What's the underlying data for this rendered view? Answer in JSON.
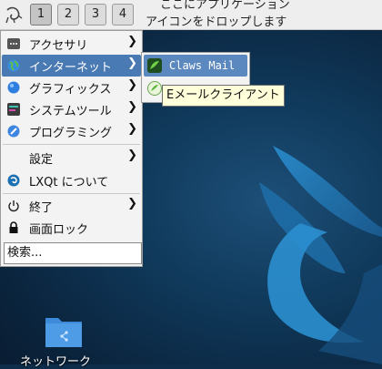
{
  "panel": {
    "desktops": [
      "1",
      "2",
      "3",
      "4"
    ],
    "active_desktop": "1",
    "quicklaunch_hint_line1": "ここにアプリケーション",
    "quicklaunch_hint_line2": "アイコンをドロップします"
  },
  "main_menu": {
    "items": [
      {
        "label": "アクセサリ",
        "icon": "accessories-icon",
        "has_submenu": true
      },
      {
        "label": "インターネット",
        "icon": "internet-globe-icon",
        "has_submenu": true,
        "highlighted": true
      },
      {
        "label": "グラフィックス",
        "icon": "graphics-icon",
        "has_submenu": true
      },
      {
        "label": "システムツール",
        "icon": "system-tools-icon",
        "has_submenu": true
      },
      {
        "label": "プログラミング",
        "icon": "programming-icon",
        "has_submenu": true
      },
      {
        "label": "設定",
        "icon": "settings-icon",
        "has_submenu": true
      },
      {
        "label": "LXQt について",
        "icon": "lxqt-logo-icon",
        "has_submenu": false
      },
      {
        "label": "終了",
        "icon": "power-icon",
        "has_submenu": true
      },
      {
        "label": "画面ロック",
        "icon": "lock-icon",
        "has_submenu": false
      }
    ],
    "search_placeholder": "検索..."
  },
  "submenu": {
    "items": [
      {
        "label": "Claws Mail",
        "icon": "claws-mail-icon",
        "highlighted": true
      },
      {
        "label": "",
        "icon": "mail-client-icon"
      }
    ]
  },
  "tooltip": {
    "text": "Eメールクライアント"
  },
  "desktop_icons": [
    {
      "label": "ネットワーク",
      "icon": "network-folder-icon"
    }
  ],
  "colors": {
    "highlight": "#4a7ab4",
    "panel_bg": "#eeeeee",
    "desktop_bg": "#0d2d4a"
  }
}
